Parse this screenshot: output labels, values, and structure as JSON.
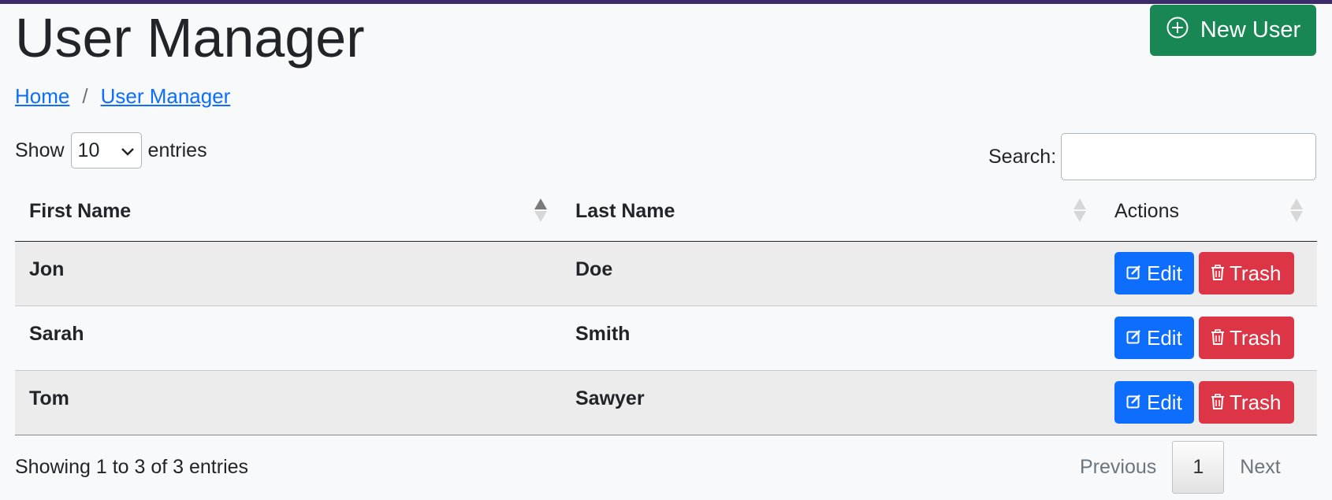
{
  "header": {
    "title": "User Manager",
    "new_user_label": "New User"
  },
  "breadcrumb": {
    "home": "Home",
    "separator": "/",
    "current": "User Manager"
  },
  "length": {
    "show_label": "Show",
    "value": "10",
    "entries_label": "entries"
  },
  "search": {
    "label": "Search:",
    "value": ""
  },
  "table": {
    "columns": [
      "First Name",
      "Last Name",
      "Actions"
    ],
    "rows": [
      {
        "first": "Jon",
        "last": "Doe"
      },
      {
        "first": "Sarah",
        "last": "Smith"
      },
      {
        "first": "Tom",
        "last": "Sawyer"
      }
    ],
    "edit_label": "Edit",
    "trash_label": "Trash"
  },
  "footer": {
    "info": "Showing 1 to 3 of 3 entries",
    "previous": "Previous",
    "current_page": "1",
    "next": "Next"
  },
  "colors": {
    "primary": "#0d6efd",
    "success": "#198754",
    "danger": "#dc3545"
  }
}
